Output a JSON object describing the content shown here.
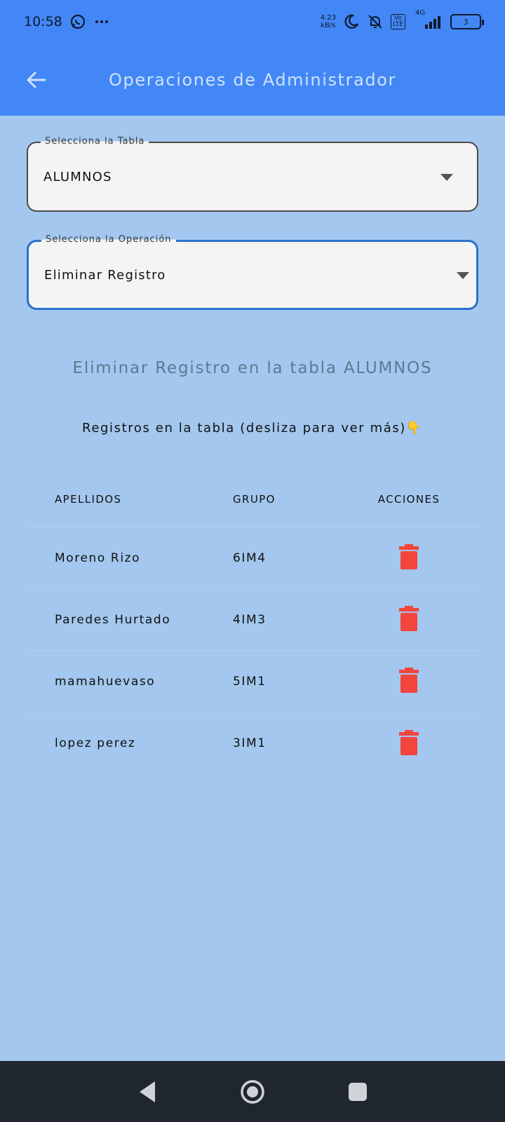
{
  "status_bar": {
    "time": "10:58",
    "net_speed": "4.23",
    "net_unit": "kB/s",
    "volte_top": "Vo",
    "volte_bottom": "LTE",
    "signal_type": "4G",
    "battery": "3"
  },
  "app_bar": {
    "title": "Operaciones de Administrador"
  },
  "table_select": {
    "label": "Selecciona la Tabla",
    "value": "ALUMNOS"
  },
  "operation_select": {
    "label": "Selecciona la Operación",
    "value": "Eliminar Registro"
  },
  "section": {
    "title": "Eliminar Registro en la tabla ALUMNOS",
    "subtitle": "Registros en la tabla (desliza para ver más)👇"
  },
  "records_table": {
    "headers": [
      "APELLIDOS",
      "GRUPO",
      "ACCIONES"
    ],
    "rows": [
      {
        "apellidos": "Moreno Rizo",
        "grupo": "6IM4"
      },
      {
        "apellidos": "Paredes Hurtado",
        "grupo": "4IM3"
      },
      {
        "apellidos": "mamahuevaso",
        "grupo": "5IM1"
      },
      {
        "apellidos": "lopez perez",
        "grupo": "3IM1"
      }
    ]
  },
  "colors": {
    "primary": "#4287f5",
    "background": "#a3c7ee",
    "delete": "#f2453d",
    "focus": "#2a72c9"
  }
}
